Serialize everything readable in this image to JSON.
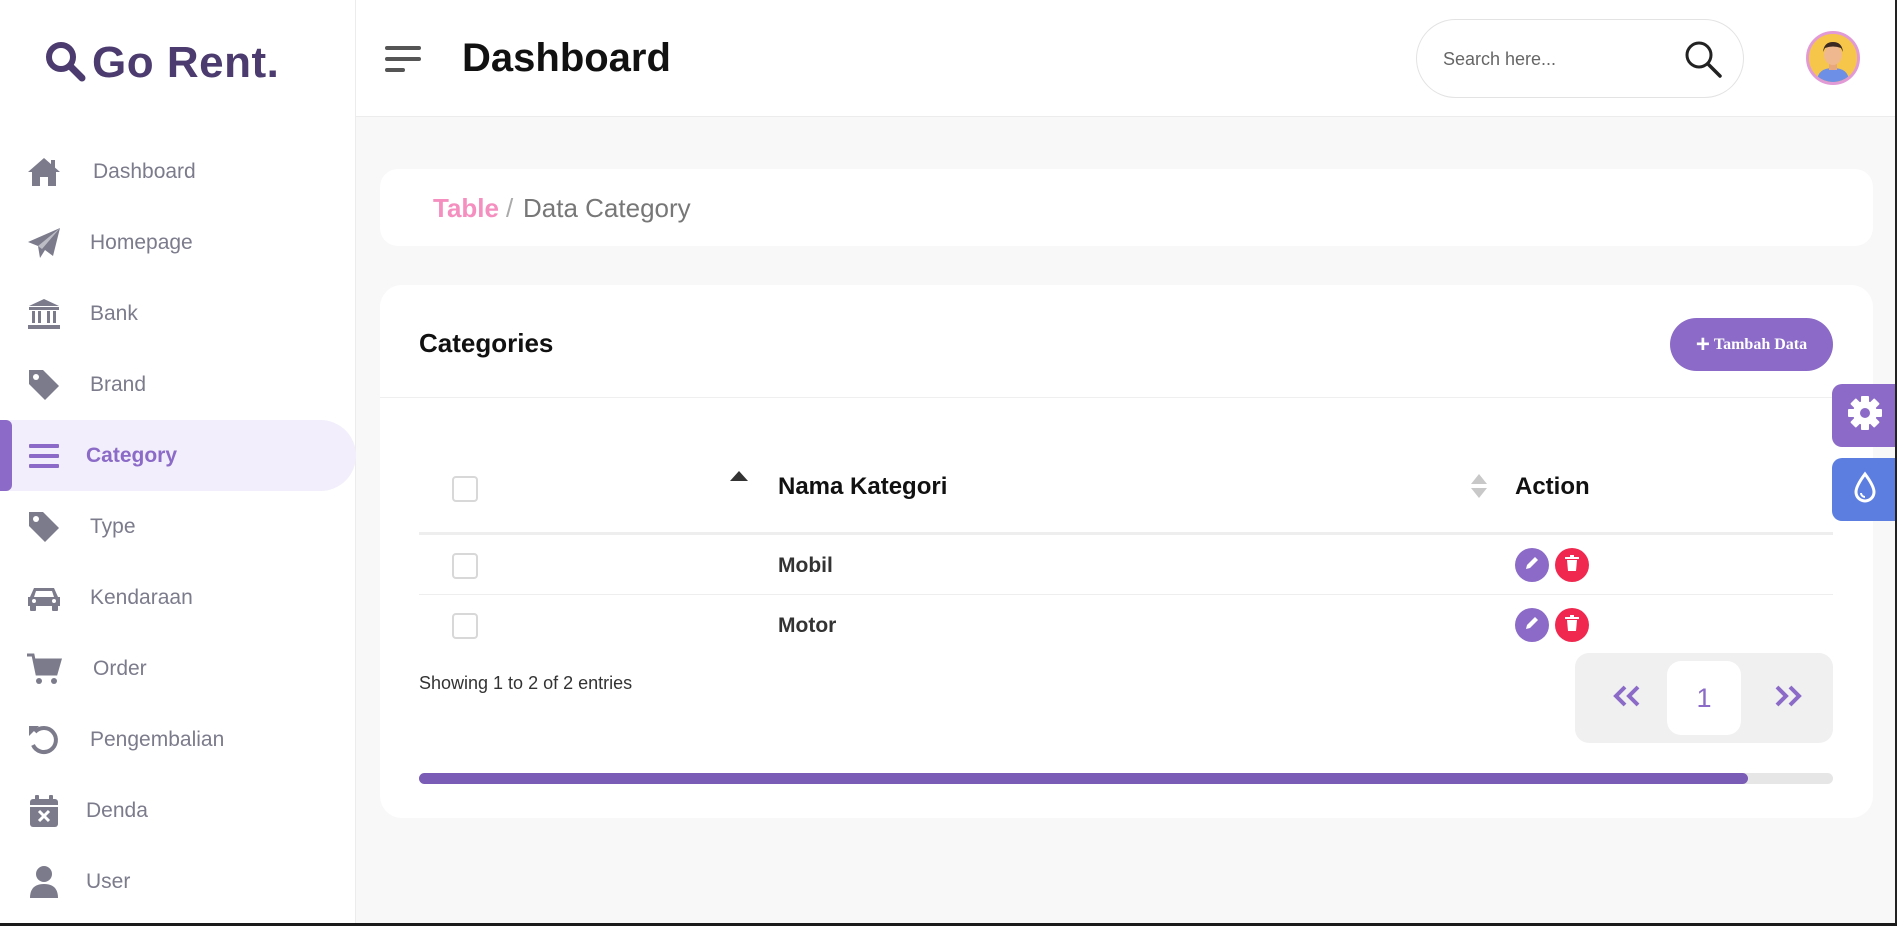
{
  "brand": {
    "name": "Go Rent.",
    "icon": "magnifier-logo-icon"
  },
  "sidebar": {
    "items": [
      {
        "label": "Dashboard",
        "icon": "home-icon",
        "active": false
      },
      {
        "label": "Homepage",
        "icon": "paper-plane-icon",
        "active": false
      },
      {
        "label": "Bank",
        "icon": "bank-icon",
        "active": false
      },
      {
        "label": "Brand",
        "icon": "tag-icon",
        "active": false
      },
      {
        "label": "Category",
        "icon": "list-icon",
        "active": true
      },
      {
        "label": "Type",
        "icon": "tag-icon",
        "active": false
      },
      {
        "label": "Kendaraan",
        "icon": "car-icon",
        "active": false
      },
      {
        "label": "Order",
        "icon": "cart-icon",
        "active": false
      },
      {
        "label": "Pengembalian",
        "icon": "undo-icon",
        "active": false
      },
      {
        "label": "Denda",
        "icon": "calendar-x-icon",
        "active": false
      },
      {
        "label": "User",
        "icon": "user-icon",
        "active": false
      }
    ]
  },
  "header": {
    "title": "Dashboard",
    "search_placeholder": "Search here..."
  },
  "breadcrumb": {
    "root": "Table",
    "separator": "/",
    "current": "Data Category"
  },
  "card": {
    "title": "Categories",
    "add_button": "Tambah Data"
  },
  "table": {
    "columns": [
      "Nama Kategori",
      "Action"
    ],
    "rows": [
      {
        "name": "Mobil"
      },
      {
        "name": "Motor"
      }
    ],
    "info": "Showing 1 to 2 of 2 entries",
    "current_page": "1",
    "horizontal_scroll_fraction": 0.94
  },
  "colors": {
    "accent": "#8b6bc7",
    "delete": "#f0284f",
    "breadcrumb_root": "#f48fbf",
    "drop_button": "#5b7ee0"
  }
}
